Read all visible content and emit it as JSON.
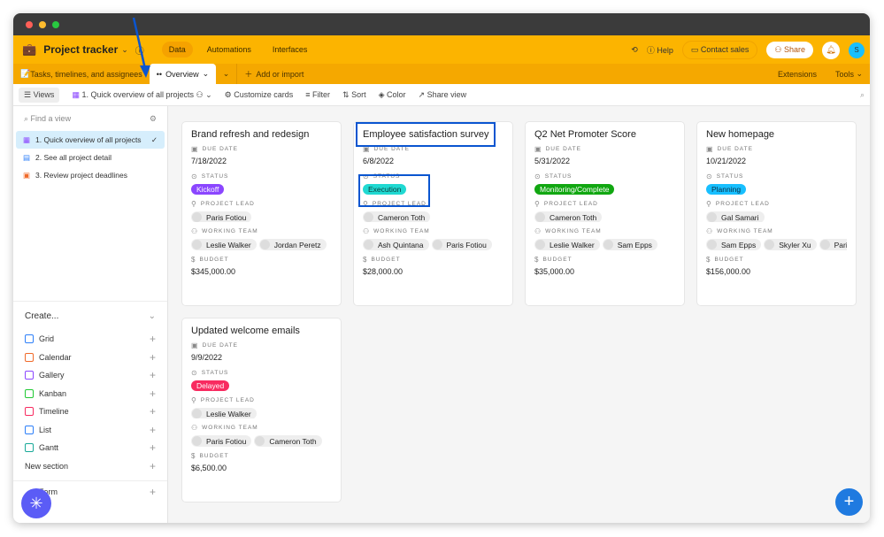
{
  "header": {
    "title": "Project tracker",
    "nav": [
      "Data",
      "Automations",
      "Interfaces"
    ],
    "help": "Help",
    "contact": "Contact sales",
    "share": "Share",
    "avatar": "S"
  },
  "tabs": {
    "items": [
      "Tasks, timelines, and assignees",
      "Overview"
    ],
    "add": "Add or import",
    "extensions": "Extensions",
    "tools": "Tools"
  },
  "toolbar": {
    "views": "Views",
    "current_view": "1. Quick overview of all projects",
    "customize": "Customize cards",
    "filter": "Filter",
    "sort": "Sort",
    "color": "Color",
    "share_view": "Share view"
  },
  "sidebar": {
    "find_placeholder": "Find a view",
    "views": [
      "1. Quick overview of all projects",
      "2. See all project detail",
      "3. Review project deadlines"
    ],
    "create_label": "Create...",
    "create": [
      {
        "label": "Grid",
        "color": "#2d7ff9"
      },
      {
        "label": "Calendar",
        "color": "#f06a2a"
      },
      {
        "label": "Gallery",
        "color": "#8b46ff"
      },
      {
        "label": "Kanban",
        "color": "#20c933"
      },
      {
        "label": "Timeline",
        "color": "#f82b60"
      },
      {
        "label": "List",
        "color": "#2d7ff9"
      },
      {
        "label": "Gantt",
        "color": "#18a999"
      }
    ],
    "new_section": "New section",
    "form": "Form"
  },
  "labels": {
    "due": "DUE DATE",
    "status": "STATUS",
    "lead": "PROJECT LEAD",
    "team": "WORKING TEAM",
    "budget": "BUDGET"
  },
  "cards": [
    {
      "title": "Brand refresh and redesign",
      "due": "7/18/2022",
      "status": "Kickoff",
      "status_bg": "#8b46ff",
      "status_fg": "#fff",
      "lead": "Paris Fotiou",
      "team": [
        "Leslie Walker",
        "Jordan Peretz"
      ],
      "budget": "$345,000.00"
    },
    {
      "title": "Employee satisfaction survey",
      "due": "6/8/2022",
      "status": "Execution",
      "status_bg": "#20d9d2",
      "status_fg": "#0b3b3a",
      "lead": "Cameron Toth",
      "team": [
        "Ash Quintana",
        "Paris Fotiou"
      ],
      "budget": "$28,000.00"
    },
    {
      "title": "Q2 Net Promoter Score",
      "due": "5/31/2022",
      "status": "Monitoring/Complete",
      "status_bg": "#11a711",
      "status_fg": "#fff",
      "lead": "Cameron Toth",
      "team": [
        "Leslie Walker",
        "Sam Epps"
      ],
      "budget": "$35,000.00"
    },
    {
      "title": "New homepage",
      "due": "10/21/2022",
      "status": "Planning",
      "status_bg": "#18bfff",
      "status_fg": "#0b2f44",
      "lead": "Gal Samari",
      "team": [
        "Sam Epps",
        "Skyler Xu",
        "Paris"
      ],
      "budget": "$156,000.00"
    },
    {
      "title": "Updated welcome emails",
      "due": "9/9/2022",
      "status": "Delayed",
      "status_bg": "#f82b60",
      "status_fg": "#fff",
      "lead": "Leslie Walker",
      "team": [
        "Paris Fotiou",
        "Cameron Toth"
      ],
      "budget": "$6,500.00"
    }
  ]
}
